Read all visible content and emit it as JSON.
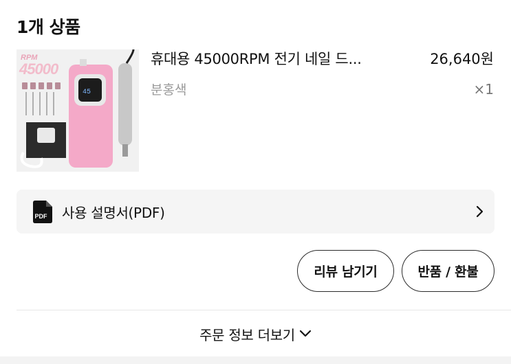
{
  "section": {
    "title": "1개 상품"
  },
  "product": {
    "name": "휴대용 45000RPM 전기 네일 드...",
    "price": "26,640원",
    "option": "분홍색",
    "quantity": "×1",
    "image": {
      "rpm_text": "RPM",
      "rpm_number": "45000",
      "display_value": "45",
      "icon": "nail-drill-product-image",
      "colors": {
        "device": "#f4a9c8",
        "background": "#f1f1f1",
        "handpiece": "#c8c8c8"
      }
    }
  },
  "manual": {
    "label": "사용 설명서(PDF)",
    "icon_text": "PDF",
    "icon": "pdf-file-icon",
    "chevron": "chevron-right-icon"
  },
  "actions": {
    "review_label": "리뷰 남기기",
    "return_label": "반품 / 환불"
  },
  "more": {
    "label": "주문 정보 더보기",
    "icon": "chevron-down-icon"
  }
}
